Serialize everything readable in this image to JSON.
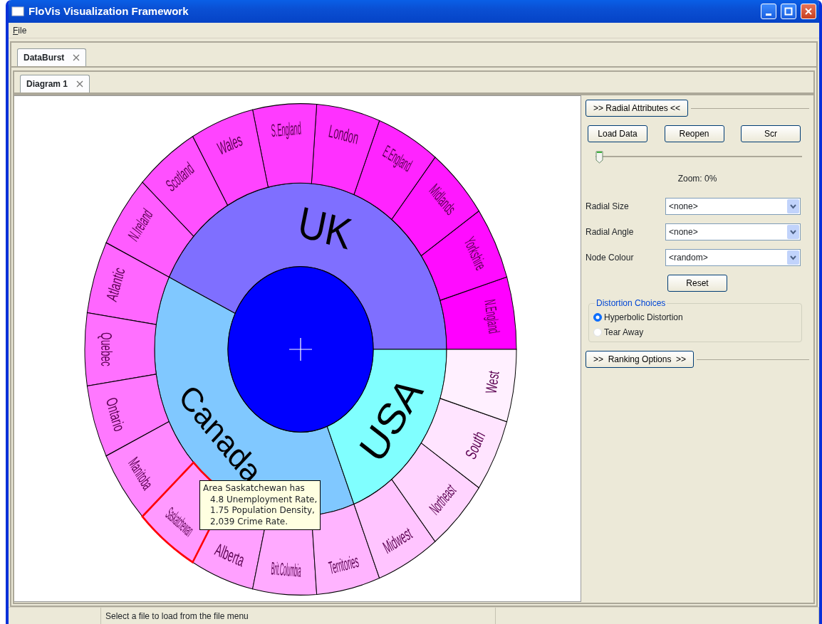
{
  "window": {
    "title": "FloVis Visualization Framework"
  },
  "menu": [
    {
      "label": "File"
    }
  ],
  "outer_tabs": [
    {
      "label": "DataBurst",
      "selected": true
    }
  ],
  "inner_tabs": [
    {
      "label": "Diagram 1",
      "selected": true
    }
  ],
  "diagram": {
    "root": {
      "color": "#0000ff"
    },
    "children": [
      {
        "label": "UK",
        "color": "#7f6fff",
        "children": [
          {
            "label": "N.England",
            "color": "#ff00ff",
            "selected": false
          },
          {
            "label": "Yorkshire",
            "color": "#ff0cff",
            "selected": false
          },
          {
            "label": "Midlands",
            "color": "#ff18ff",
            "selected": false
          },
          {
            "label": "E.England",
            "color": "#ff24ff",
            "selected": false
          },
          {
            "label": "London",
            "color": "#ff30ff",
            "selected": false
          },
          {
            "label": "S.England",
            "color": "#ff3cff",
            "selected": false
          },
          {
            "label": "Wales",
            "color": "#ff44ff",
            "selected": false
          },
          {
            "label": "Scotland",
            "color": "#ff50ff",
            "selected": false
          },
          {
            "label": "N.Ireland",
            "color": "#ff5cff",
            "selected": false
          }
        ]
      },
      {
        "label": "Canada",
        "color": "#80c8ff",
        "children": [
          {
            "label": "Atlantic",
            "color": "#ff66ff",
            "selected": false
          },
          {
            "label": "Quebec",
            "color": "#ff70ff",
            "selected": false
          },
          {
            "label": "Ontario",
            "color": "#ff78ff",
            "selected": false
          },
          {
            "label": "Manitoba",
            "color": "#ff88ff",
            "selected": false
          },
          {
            "label": "Saskatchewan",
            "color": "#ff99ff",
            "selected": true
          },
          {
            "label": "Alberta",
            "color": "#ffa0ff",
            "selected": false
          },
          {
            "label": "Brit.Columbia",
            "color": "#ffaaff",
            "selected": false
          },
          {
            "label": "Territories",
            "color": "#ffb4ff",
            "selected": false
          }
        ]
      },
      {
        "label": "USA",
        "color": "#80ffff",
        "children": [
          {
            "label": "Midwest",
            "color": "#ffc4ff",
            "selected": false
          },
          {
            "label": "Northeast",
            "color": "#ffd4ff",
            "selected": false
          },
          {
            "label": "South",
            "color": "#ffe4ff",
            "selected": false
          },
          {
            "label": "West",
            "color": "#fff0ff",
            "selected": false
          }
        ]
      }
    ],
    "tooltip": {
      "lines": [
        "Area Saskatchewan has",
        "4.8 Unemployment Rate,",
        "1.75 Population Density,",
        "2,039 Crime Rate."
      ]
    }
  },
  "panel": {
    "radial_toggle": ">> Radial Attributes <<",
    "buttons": [
      "Load Data",
      "Reopen",
      "Scr"
    ],
    "slider": {
      "level": 0
    },
    "zoom_label": "Zoom: 0%",
    "fields": [
      {
        "label": "Radial Size",
        "value": "<none>"
      },
      {
        "label": "Radial Angle",
        "value": "<none>"
      },
      {
        "label": "Node Colour",
        "value": "<random>"
      }
    ],
    "reset": "Reset",
    "distortion": {
      "title": "Distortion Choices",
      "options": [
        {
          "label": "Hyperbolic Distortion",
          "selected": true
        },
        {
          "label": "Tear Away",
          "selected": false
        }
      ]
    },
    "ranking_toggle": ">>  Ranking Options  >>"
  },
  "status_bar": {
    "text": "Select a file to load from the file menu"
  }
}
